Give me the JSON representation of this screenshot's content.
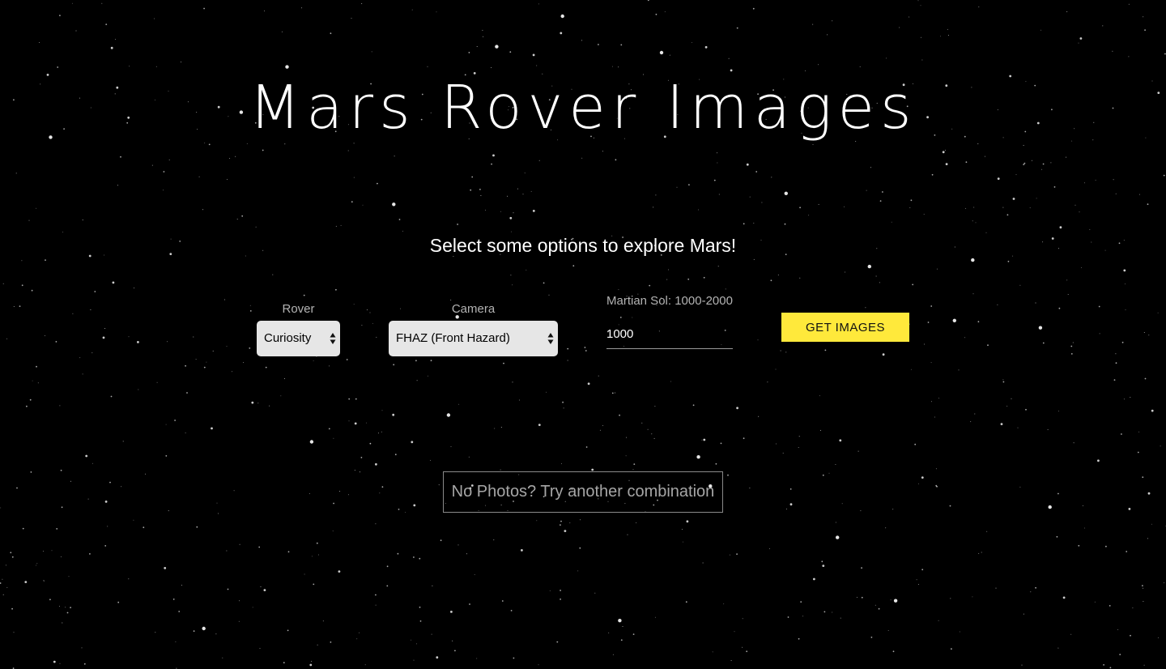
{
  "header": {
    "title": "Mars Rover Images",
    "subtitle": "Select some options to explore Mars!"
  },
  "form": {
    "rover": {
      "label": "Rover",
      "selected": "Curiosity"
    },
    "camera": {
      "label": "Camera",
      "selected": "FHAZ (Front Hazard)"
    },
    "sol": {
      "label": "Martian Sol: 1000-2000",
      "value": "1000"
    },
    "submit_label": "GET IMAGES"
  },
  "results": {
    "empty_message": "No Photos? Try another combination"
  },
  "colors": {
    "background": "#000000",
    "accent": "#ffe93b",
    "select_bg": "#e6e6e6",
    "muted_text": "#b3b3b3"
  },
  "icons": {
    "select_arrows": "chevron-up-down-icon"
  }
}
